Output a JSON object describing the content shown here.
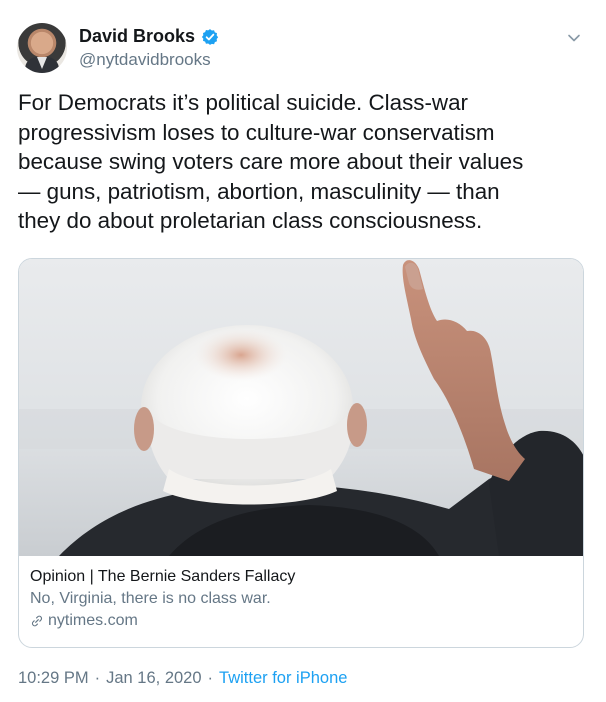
{
  "author": {
    "name": "David Brooks",
    "handle": "@nytdavidbrooks",
    "verified": true
  },
  "tweet": {
    "text": "For Democrats it’s political suicide. Class-war\nprogressivism loses to culture-war conservatism\nbecause swing voters care more about their values\n— guns, patriotism, abortion, masculinity — than\nthey do about proletarian class consciousness."
  },
  "card": {
    "title": "Opinion | The Bernie Sanders Fallacy",
    "description": "No, Virginia, there is no class war.",
    "domain": "nytimes.com"
  },
  "footer": {
    "time": "10:29 PM",
    "separator1": "·",
    "date": "Jan 16, 2020",
    "separator2": "·",
    "source": "Twitter for iPhone"
  },
  "colors": {
    "accent": "#1da1f2",
    "muted": "#657786",
    "text": "#14171a",
    "border": "#ccd6dd"
  },
  "icons": {
    "verified": "verified-badge-icon",
    "caret": "chevron-down-icon",
    "link": "link-icon"
  }
}
